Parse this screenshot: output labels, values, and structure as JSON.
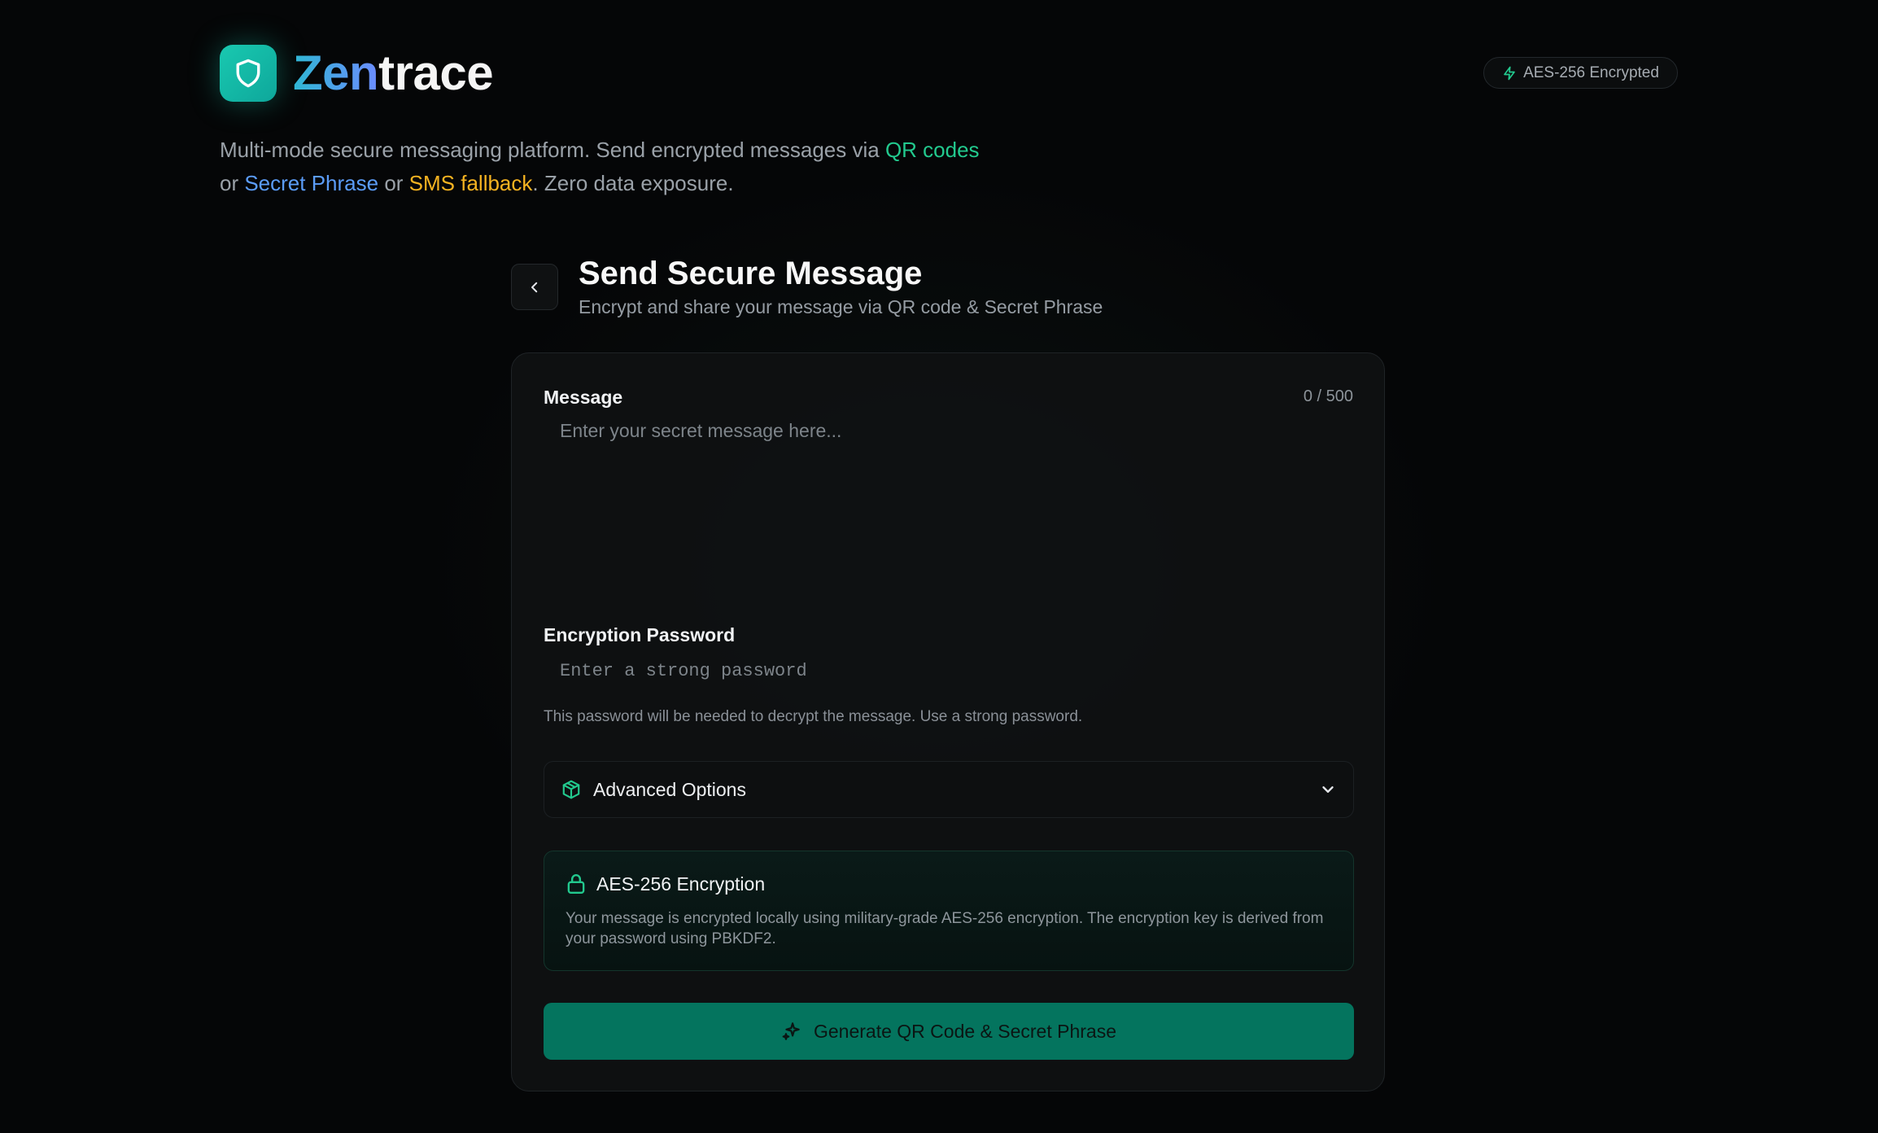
{
  "brand": {
    "name_gradient": "Zen",
    "name_rest": "trace"
  },
  "badge": {
    "label": "AES-256 Encrypted"
  },
  "tagline": {
    "intro": "Multi-mode secure messaging platform. Send encrypted messages via ",
    "qr": "QR codes",
    "or1": " or ",
    "secret_phrase": "Secret Phrase",
    "or2": " or ",
    "sms": "SMS fallback",
    "outro": ". Zero data exposure."
  },
  "header": {
    "title": "Send Secure Message",
    "subtitle": "Encrypt and share your message via QR code & Secret Phrase"
  },
  "form": {
    "message_label": "Message",
    "message_counter": "0 / 500",
    "message_placeholder": "Enter your secret message here...",
    "message_value": "",
    "password_label": "Encryption Password",
    "password_placeholder": "Enter a strong password",
    "password_value": "",
    "password_hint": "This password will be needed to decrypt the message. Use a strong password.",
    "advanced_label": "Advanced Options"
  },
  "info": {
    "title": "AES-256 Encryption",
    "text": "Your message is encrypted locally using military-grade AES-256 encryption. The encryption key is derived from your password using PBKDF2."
  },
  "actions": {
    "generate_label": "Generate QR Code & Secret Phrase"
  },
  "colors": {
    "accent": "#19c9b0",
    "qr": "#22c98e",
    "secret_phrase": "#5b9cf7",
    "sms": "#f5b321",
    "button": "#04745e"
  },
  "icons": {
    "logo": "shield-icon",
    "badge": "lightning-icon",
    "back": "chevron-left-icon",
    "advanced": "package-icon",
    "advanced_toggle": "chevron-down-icon",
    "info": "lock-icon",
    "generate": "sparkles-icon"
  }
}
